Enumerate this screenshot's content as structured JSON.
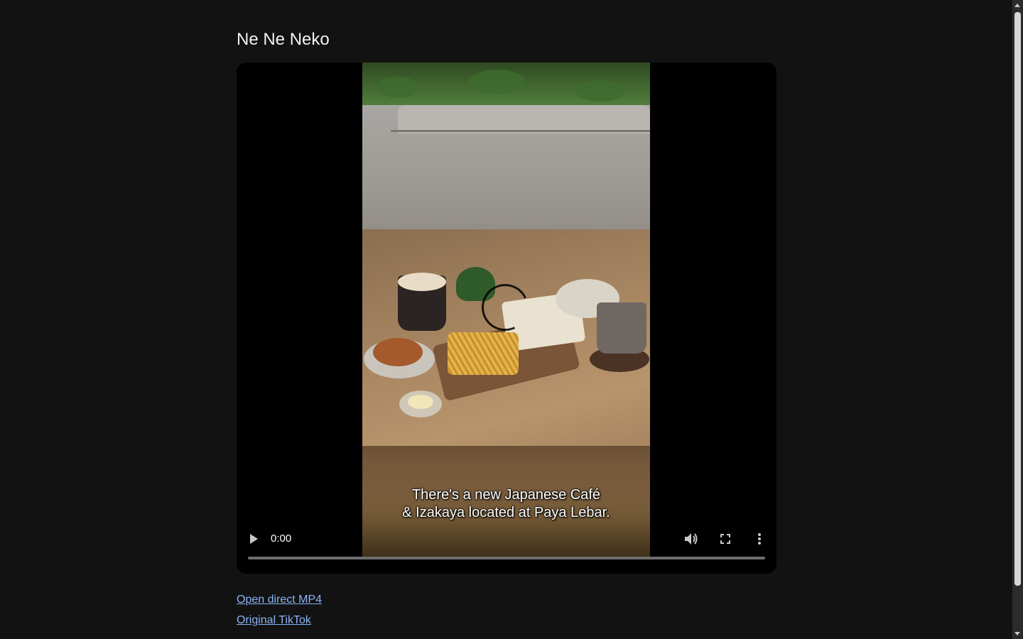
{
  "page": {
    "title": "Ne Ne Neko"
  },
  "player": {
    "time": "0:00",
    "progress": 0,
    "captions": [
      "There's a new Japanese Café",
      "& Izakaya located at Paya Lebar."
    ],
    "icons": {
      "play": "play-icon",
      "mute": "volume-icon",
      "fullscreen": "fullscreen-icon",
      "more": "more-vert-icon",
      "loading": "spinner-icon"
    }
  },
  "links": {
    "direct_mp4": "Open direct MP4",
    "original_tiktok": "Original TikTok"
  },
  "colors": {
    "background": "#121212",
    "link": "#8ab4f8",
    "title": "#f2f2f2"
  }
}
